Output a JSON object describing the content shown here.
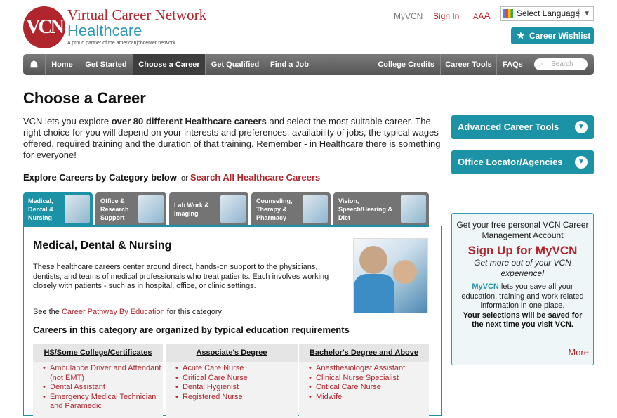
{
  "header": {
    "logo_text": "VCN",
    "brand_line1": "Virtual Career Network",
    "brand_line2": "Healthcare",
    "brand_tagline": "A proud partner of the americanjobcenter network",
    "myvcn": "MyVCN",
    "sign_in": "Sign In",
    "aaa": [
      "A",
      "A",
      "A"
    ],
    "language": "Select Language",
    "wishlist": "Career Wishlist"
  },
  "nav": {
    "items": [
      "Home",
      "Get Started",
      "Choose a Career",
      "Get Qualified",
      "Find a Job",
      "College Credits",
      "Career Tools",
      "FAQs"
    ],
    "search_placeholder": "Search"
  },
  "main": {
    "title": "Choose a Career",
    "intro_pre": "VCN lets you explore ",
    "intro_bold": "over 80 different Healthcare careers",
    "intro_post": " and select the most suitable career. The right choice for you will depend on your interests and preferences, availability of jobs, the typical wages offered, required training and the duration of that training. Remember - in Healthcare there is something for everyone!",
    "explore_bold": "Explore Careers by Category below",
    "explore_or": ", or ",
    "explore_link": "Search All Healthcare Careers"
  },
  "tabs": [
    {
      "label": "Medical, Dental & Nursing"
    },
    {
      "label": "Office & Research Support"
    },
    {
      "label": "Lab Work & Imaging"
    },
    {
      "label": "Counseling, Therapy & Pharmacy"
    },
    {
      "label": "Vision, Speech/Hearing & Diet"
    }
  ],
  "panel": {
    "heading": "Medical, Dental & Nursing",
    "description": "These healthcare careers center around direct, hands-on support to the physicians, dentists, and teams of medical professionals who treat patients. Each involves working closely with patients - such as in hospital, office, or clinic settings.",
    "pathway_pre": "See the ",
    "pathway_link": "Career Pathway By Education",
    "pathway_post": " for this category",
    "organized": "Careers in this category are organized by typical education requirements",
    "columns": [
      {
        "header": "HS/Some College/Certificates",
        "items": [
          "Ambulance Driver and Attendant (not EMT)",
          "Dental Assistant",
          "Emergency Medical Technician and Paramedic"
        ]
      },
      {
        "header": "Associate's Degree",
        "items": [
          "Acute Care Nurse",
          "Critical Care Nurse",
          "Dental Hygienist",
          "Registered Nurse"
        ]
      },
      {
        "header": "Bachelor's Degree and Above",
        "items": [
          "Anesthesiologist Assistant",
          "Clinical Nurse Specialist",
          "Critical Care Nurse",
          "Midwife"
        ]
      }
    ]
  },
  "sidebar": {
    "advanced": "Advanced Career Tools",
    "office": "Office Locator/Agencies",
    "promo_line1": "Get your free personal VCN Career Management Account",
    "promo_signup": "Sign Up for MyVCN",
    "promo_sub": "Get more out of your VCN experience!",
    "promo_myvcn": "MyVCN",
    "promo_body": " lets you save all your education, training and work related information in one place.",
    "promo_bold": "Your selections will be saved for the next time you visit VCN.",
    "promo_more": "More"
  },
  "colors": {
    "teal": "#1c92a6",
    "brand_red": "#b0262c",
    "nav_gray": "#555555"
  }
}
